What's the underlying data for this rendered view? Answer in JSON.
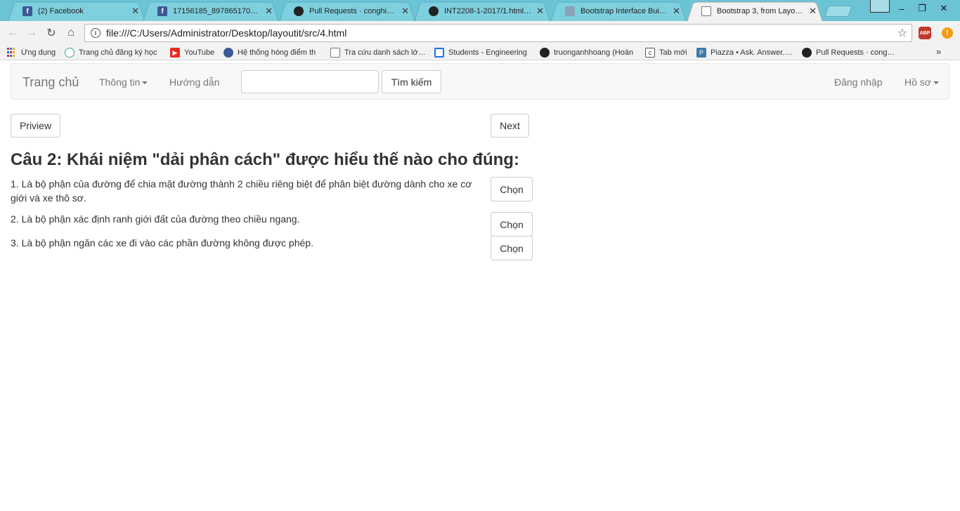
{
  "browser": {
    "tabs": [
      {
        "title": "(2) Facebook",
        "icon": "facebook-icon",
        "active": false
      },
      {
        "title": "17156185_897865170355140",
        "icon": "facebook-icon",
        "active": false
      },
      {
        "title": "Pull Requests · conghieutv",
        "icon": "github-icon",
        "active": false
      },
      {
        "title": "INT2208-1-2017/1.html at",
        "icon": "github-icon",
        "active": false
      },
      {
        "title": "Bootstrap Interface Builder",
        "icon": "bootstrap-icon",
        "active": false
      },
      {
        "title": "Bootstrap 3, from LayoutIt!",
        "icon": "document-icon",
        "active": true
      }
    ],
    "window_controls": {
      "minimize": "–",
      "restore": "❐",
      "close": "✕"
    },
    "address_bar": {
      "url": "file:///C:/Users/Administrator/Desktop/layoutit/src/4.html"
    },
    "bookmarks": [
      {
        "label": "Ứng dụng",
        "icon": "apps-grid-icon"
      },
      {
        "label": "Trang chủ đăng ký học",
        "icon": "site-icon"
      },
      {
        "label": "YouTube",
        "icon": "youtube-icon"
      },
      {
        "label": "Hệ thống hóng điểm th",
        "icon": "globe-icon"
      },
      {
        "label": "Tra cứu danh sách lớp m",
        "icon": "document-icon"
      },
      {
        "label": "Students - Engineering",
        "icon": "site-icon"
      },
      {
        "label": "truonganhhoang (Hoàn",
        "icon": "github-icon"
      },
      {
        "label": "Tab mới",
        "icon": "page-icon"
      },
      {
        "label": "Piazza • Ask. Answer. Ex",
        "icon": "piazza-icon"
      },
      {
        "label": "Pull Requests · conghieu",
        "icon": "github-icon"
      }
    ],
    "more_bookmarks": "»",
    "abp_label": "ABP",
    "alert_label": "!"
  },
  "navbar": {
    "brand": "Trang chủ",
    "info_label": "Thông tin",
    "guide_label": "Hướng dẫn",
    "search_value": "",
    "search_button": "Tìm kiếm",
    "login_label": "Đăng nhập",
    "profile_label": "Hồ sơ"
  },
  "pager": {
    "prev_label": "Priview",
    "next_label": "Next"
  },
  "question": {
    "text": "Câu 2: Khái niệm \"dải phân cách\" được hiểu thế nào cho đúng:",
    "choose_label": "Chọn",
    "answers": [
      "1. Là bộ phận của đường để chia mặt đường thành 2 chiều riêng biệt để phân biệt đường dành cho xe cơ giới và xe thô sơ.",
      "2. Là bộ phận xác định ranh giới đất của đường theo chiều ngang.",
      "3. Là bộ phận ngăn các xe đi vào các phần đường không được phép."
    ]
  }
}
